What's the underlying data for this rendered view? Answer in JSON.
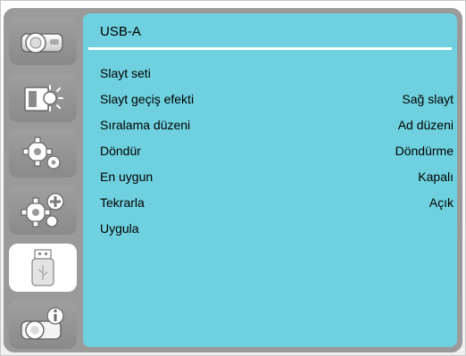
{
  "menu": {
    "title": "USB-A",
    "items": [
      {
        "label": "Slayt seti",
        "value": ""
      },
      {
        "label": "Slayt geçiş efekti",
        "value": "Sağ slayt"
      },
      {
        "label": "Sıralama düzeni",
        "value": "Ad düzeni"
      },
      {
        "label": "Döndür",
        "value": "Döndürme"
      },
      {
        "label": "En uygun",
        "value": "Kapalı"
      },
      {
        "label": "Tekrarla",
        "value": "Açık"
      },
      {
        "label": "Uygula",
        "value": ""
      }
    ]
  },
  "sidebar": {
    "items": [
      {
        "icon": "projector-icon"
      },
      {
        "icon": "image-brightness-icon"
      },
      {
        "icon": "gear-icon"
      },
      {
        "icon": "advanced-gear-icon"
      },
      {
        "icon": "usb-drive-icon",
        "active": true
      },
      {
        "icon": "projector-info-icon"
      }
    ]
  },
  "colors": {
    "content_bg": "#6fd1df",
    "sidebar_bg": "#9a9a9a",
    "active_tab_bg": "#ffffff"
  }
}
